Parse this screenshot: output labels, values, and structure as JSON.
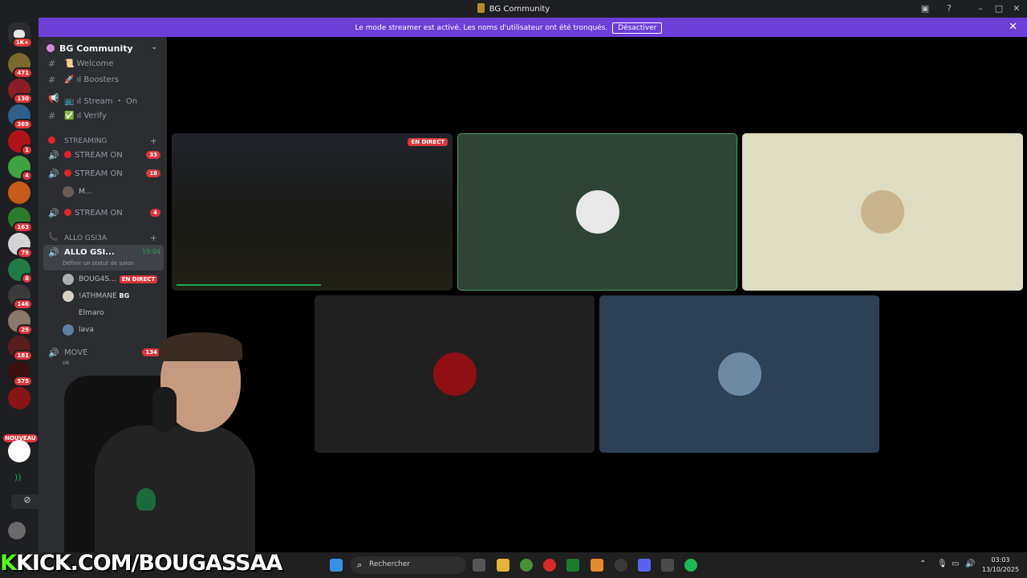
{
  "window": {
    "title": "BG Community"
  },
  "notice": {
    "message": "Le mode streamer est activé. Les noms d'utilisateur ont été tronqués.",
    "disable_label": "Désactiver"
  },
  "server_rail": {
    "home_badge": "1K+",
    "servers": [
      {
        "badge": "471",
        "color": "#7a6a2e"
      },
      {
        "badge": "130",
        "color": "#8c1e23"
      },
      {
        "badge": "369",
        "color": "#2e5e8a"
      },
      {
        "badge": "1",
        "color": "#b0141a"
      },
      {
        "badge": "4",
        "color": "#3fa142"
      },
      {
        "badge": "",
        "color": "#c85a1a"
      },
      {
        "badge": "163",
        "color": "#2d7a2d"
      },
      {
        "badge": "79",
        "color": "#d4d4d4"
      },
      {
        "badge": "8",
        "color": "#1f7a44"
      },
      {
        "badge": "146",
        "color": "#3a3a3a"
      },
      {
        "badge": "29",
        "color": "#8a7a6a"
      },
      {
        "badge": "181",
        "color": "#5a1d1d"
      },
      {
        "badge": "575",
        "color": "#3a1010"
      },
      {
        "badge": "",
        "color": "#8a1414"
      }
    ],
    "new_label": "NOUVEAU"
  },
  "sidebar": {
    "guild_name": "BG Community",
    "channels_top": [
      {
        "icon": "#",
        "label": "📜 Welcome"
      },
      {
        "icon": "#",
        "label": "🚀 ıl Boosters"
      },
      {
        "icon": "📢",
        "label": "📺 ıl Stream ・ On"
      },
      {
        "icon": "#",
        "label": "✅ ıl Verify"
      }
    ],
    "cat_streaming": "STREAMING",
    "streaming": [
      {
        "label": "STREAM ON",
        "count": "33"
      },
      {
        "label": "STREAM ON",
        "count": "18"
      }
    ],
    "stream_user": "M...",
    "stream_on_3": {
      "label": "STREAM ON",
      "count": "4"
    },
    "cat_allo": "ALLO GSI3A",
    "allo_channel": {
      "label": "ALLO GSI...",
      "time": "19:04",
      "status": "Définir un statut de salon"
    },
    "voice_users": [
      {
        "name": "BOUG4S...",
        "live": "EN DIRECT"
      },
      {
        "name": "!ATHMANE",
        "tag": "BG"
      },
      {
        "name": "Elmaro"
      },
      {
        "name": "lava"
      }
    ],
    "move_channel": {
      "label": "MOVE",
      "count": "134",
      "sub": "ok"
    }
  },
  "stage": {
    "live_label": "EN DIRECT"
  },
  "overlay": {
    "kick_url": "KICK.COM/BOUGASSAA"
  },
  "taskbar": {
    "search_placeholder": "Rechercher",
    "time": "03:03",
    "date": "13/10/2025"
  },
  "colors": {
    "notice": "#6c3fd9",
    "speaking_border": "#3ba55d",
    "kick_green": "#53fc18"
  }
}
